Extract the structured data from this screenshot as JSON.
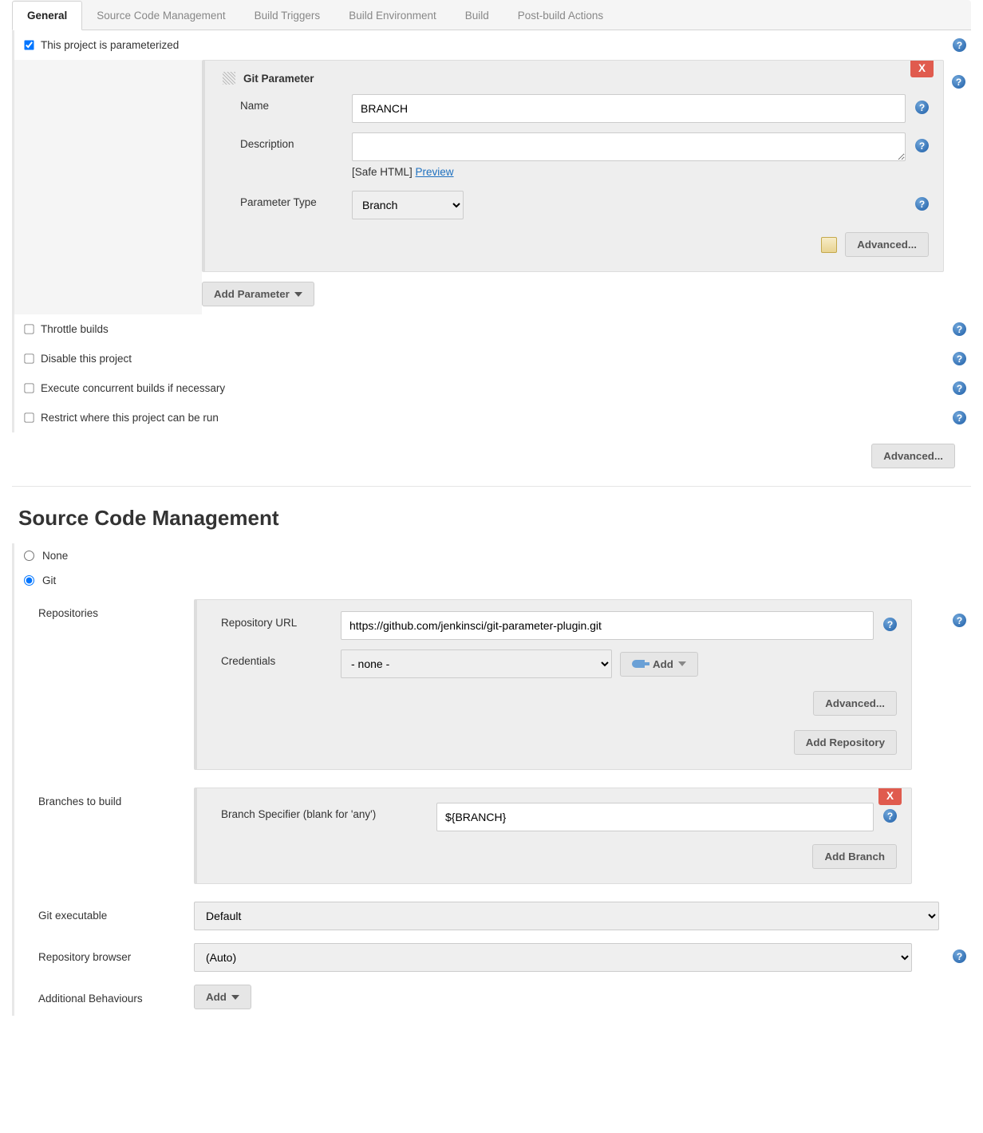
{
  "tabs": [
    "General",
    "Source Code Management",
    "Build Triggers",
    "Build Environment",
    "Build",
    "Post-build Actions"
  ],
  "general": {
    "parameterized_label": "This project is parameterized",
    "throttle_label": "Throttle builds",
    "disable_label": "Disable this project",
    "concurrent_label": "Execute concurrent builds if necessary",
    "restrict_label": "Restrict where this project can be run",
    "advanced_label": "Advanced...",
    "add_parameter_label": "Add Parameter"
  },
  "git_param": {
    "title": "Git Parameter",
    "close": "X",
    "name_label": "Name",
    "name_value": "BRANCH",
    "desc_label": "Description",
    "desc_value": "",
    "safe_html": "[Safe HTML]",
    "preview": "Preview",
    "type_label": "Parameter Type",
    "type_value": "Branch",
    "advanced_label": "Advanced..."
  },
  "scm": {
    "heading": "Source Code Management",
    "none_label": "None",
    "git_label": "Git",
    "repositories_label": "Repositories",
    "repo_url_label": "Repository URL",
    "repo_url_value": "https://github.com/jenkinsci/git-parameter-plugin.git",
    "credentials_label": "Credentials",
    "credentials_value": "- none -",
    "add_cred_label": "Add",
    "repo_advanced_label": "Advanced...",
    "add_repo_label": "Add Repository",
    "branches_label": "Branches to build",
    "branch_spec_label": "Branch Specifier (blank for 'any')",
    "branch_spec_value": "${BRANCH}",
    "add_branch_label": "Add Branch",
    "close": "X",
    "git_exec_label": "Git executable",
    "git_exec_value": "Default",
    "repo_browser_label": "Repository browser",
    "repo_browser_value": "(Auto)",
    "additional_label": "Additional Behaviours",
    "add_behaviour_label": "Add"
  }
}
